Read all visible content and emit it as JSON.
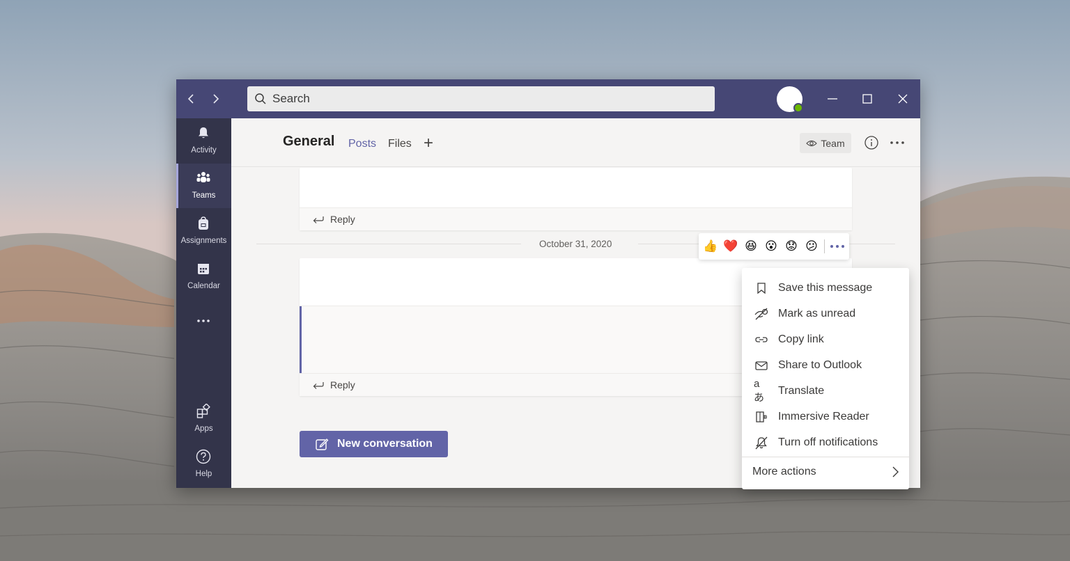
{
  "window": {
    "search": {
      "placeholder": "Search"
    },
    "controls": {
      "minimize": "minimize",
      "maximize": "maximize",
      "close": "close"
    }
  },
  "rail": {
    "items": [
      {
        "label": "Activity",
        "icon": "bell-icon",
        "active": false
      },
      {
        "label": "Teams",
        "icon": "teams-icon",
        "active": true
      },
      {
        "label": "Assignments",
        "icon": "backpack-icon",
        "active": false
      },
      {
        "label": "Calendar",
        "icon": "calendar-icon",
        "active": false
      },
      {
        "label": "",
        "icon": "more-icon",
        "active": false
      },
      {
        "label": "Apps",
        "icon": "apps-icon",
        "active": false
      },
      {
        "label": "Help",
        "icon": "help-icon",
        "active": false
      }
    ]
  },
  "header": {
    "channel": "General",
    "tabs": [
      {
        "label": "Posts",
        "active": true
      },
      {
        "label": "Files",
        "active": false
      }
    ],
    "team_button": "Team"
  },
  "messages": {
    "reply_label": "Reply",
    "date_separator": "October 31, 2020"
  },
  "reactions": [
    "👍",
    "❤️",
    "😆",
    "😮",
    "😟",
    "😕"
  ],
  "new_conversation": "New conversation",
  "context_menu": {
    "items": [
      {
        "label": "Save this message",
        "icon": "bookmark-icon"
      },
      {
        "label": "Mark as unread",
        "icon": "eye-off-icon"
      },
      {
        "label": "Copy link",
        "icon": "link-icon"
      },
      {
        "label": "Share to Outlook",
        "icon": "mail-icon"
      },
      {
        "label": "Translate",
        "icon": "translate-icon"
      },
      {
        "label": "Immersive Reader",
        "icon": "reader-icon"
      },
      {
        "label": "Turn off notifications",
        "icon": "bell-off-icon"
      }
    ],
    "more": "More actions"
  },
  "colors": {
    "brand": "#6264a7",
    "titlebar": "#464775",
    "rail": "#33344a",
    "presence": "#6bb700"
  }
}
